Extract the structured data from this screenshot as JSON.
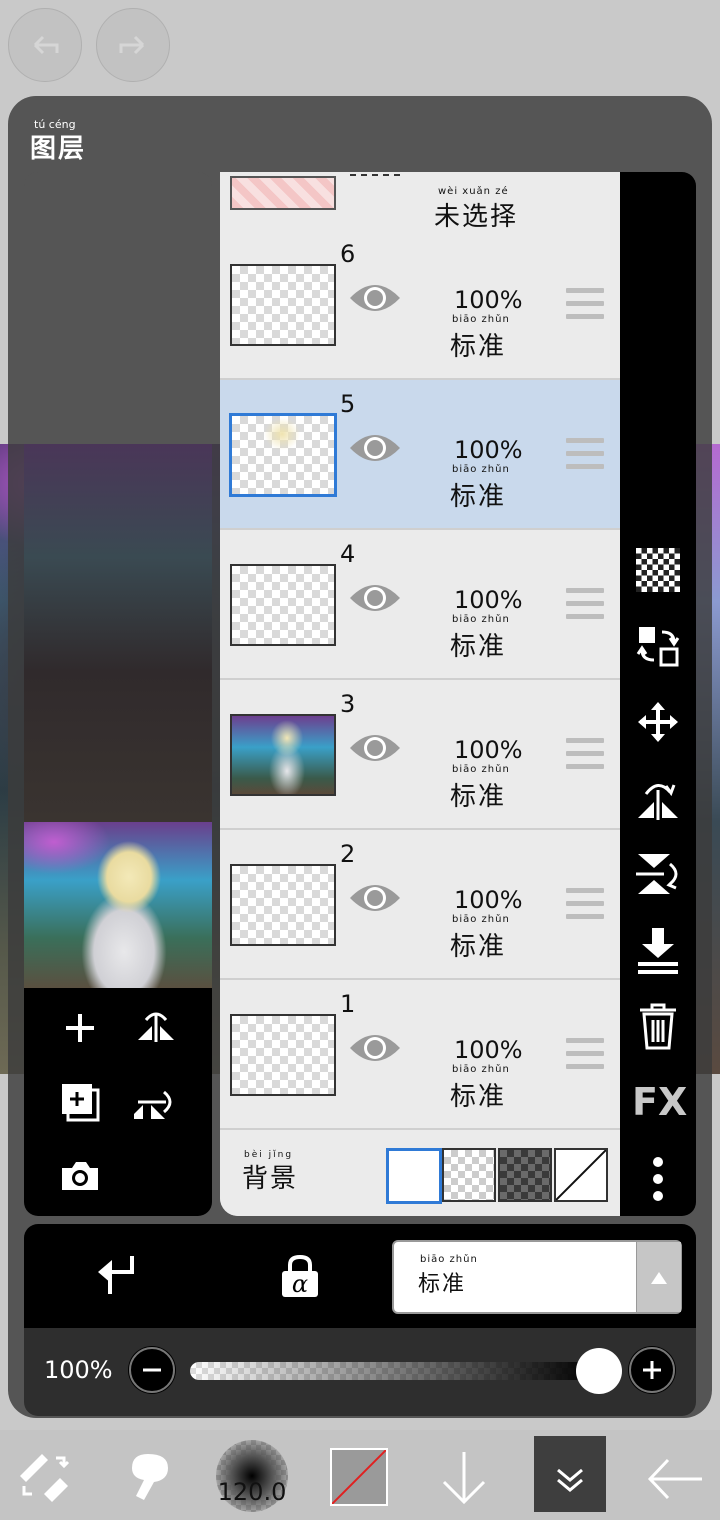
{
  "panel": {
    "title": "图层",
    "title_ruby": "tú céng"
  },
  "layers_top_label": {
    "text": "未选择",
    "ruby": "wèi xuǎn zé"
  },
  "layers": [
    {
      "number": "6",
      "opacity": "100%",
      "blend": "标准",
      "blend_ruby": "biāo zhǔn",
      "selected": false,
      "visible": true
    },
    {
      "number": "5",
      "opacity": "100%",
      "blend": "标准",
      "blend_ruby": "biāo zhǔn",
      "selected": true,
      "visible": true
    },
    {
      "number": "4",
      "opacity": "100%",
      "blend": "标准",
      "blend_ruby": "biāo zhǔn",
      "selected": false,
      "visible": true
    },
    {
      "number": "3",
      "opacity": "100%",
      "blend": "标准",
      "blend_ruby": "biāo zhǔn",
      "selected": false,
      "visible": true
    },
    {
      "number": "2",
      "opacity": "100%",
      "blend": "标准",
      "blend_ruby": "biāo zhǔn",
      "selected": false,
      "visible": true
    },
    {
      "number": "1",
      "opacity": "100%",
      "blend": "标准",
      "blend_ruby": "biāo zhǔn",
      "selected": false,
      "visible": true
    }
  ],
  "background": {
    "label": "背景",
    "ruby": "bèi jǐng",
    "options": [
      "white-icon",
      "checker-icon",
      "dark-checker-icon",
      "none-icon"
    ],
    "selected": "white-icon"
  },
  "bottom_bar": {
    "blend_mode": "标准",
    "blend_mode_ruby": "biāo zhǔn"
  },
  "opacity_slider": {
    "label": "100%",
    "value": 1.0
  },
  "toolbar": {
    "brush_size": "120.0"
  },
  "right_tools": {
    "fx_label": "FX"
  },
  "colors": {
    "selected_row": "#c9d9ec",
    "accent_blue": "#2f7ad6",
    "panel_bg": "#3c3c3c"
  }
}
